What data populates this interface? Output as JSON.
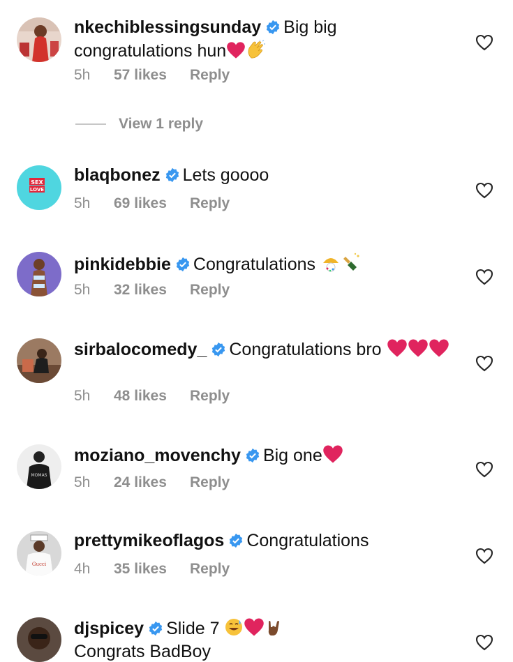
{
  "comments": [
    {
      "username": "nkechiblessingsunday",
      "text": "Big big congratulations hun",
      "time": "5h",
      "likes": "57 likes",
      "reply": "Reply",
      "avatar_color": "#c9372c"
    },
    {
      "username": "blaqbonez",
      "text": "Lets goooo",
      "time": "5h",
      "likes": "69 likes",
      "reply": "Reply",
      "avatar_color": "#4fd6e0"
    },
    {
      "username": "pinkidebbie",
      "text": "Congratulations",
      "time": "5h",
      "likes": "32 likes",
      "reply": "Reply",
      "avatar_color": "#7d6cc9"
    },
    {
      "username": "sirbalocomedy_",
      "text": "Congratulations bro",
      "time": "5h",
      "likes": "48 likes",
      "reply": "Reply",
      "avatar_color": "#8a5a3c"
    },
    {
      "username": "moziano_movenchy",
      "text": "Big one",
      "time": "5h",
      "likes": "24 likes",
      "reply": "Reply",
      "avatar_color": "#2a2a2a"
    },
    {
      "username": "prettymikeoflagos",
      "text": "Congratulations",
      "time": "4h",
      "likes": "35 likes",
      "reply": "Reply",
      "avatar_color": "#cfcfcf"
    },
    {
      "username": "djspicey",
      "text": "Slide 7",
      "text2": "Congrats BadBoy",
      "avatar_color": "#3a3a3a"
    }
  ],
  "view_replies": "View 1 reply",
  "colors": {
    "verified": "#3897f0",
    "meta": "#8e8e8e",
    "heart_red": "#e0245e"
  }
}
